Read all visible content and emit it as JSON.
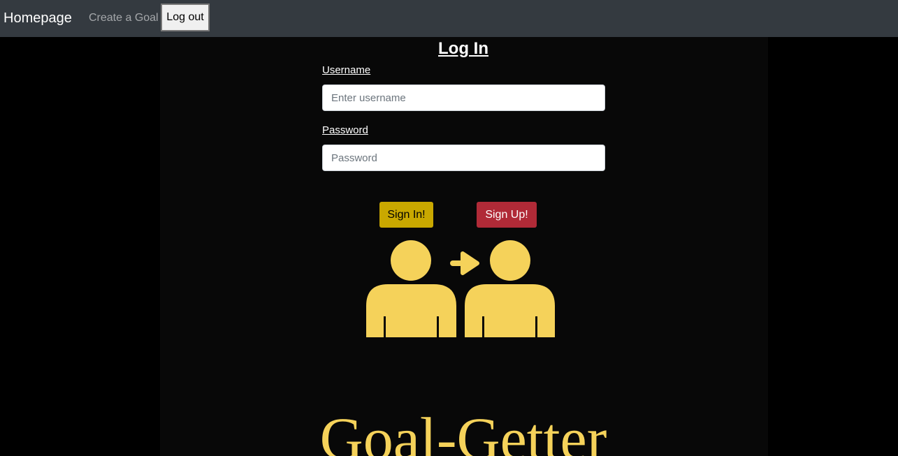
{
  "navbar": {
    "brand": "Homepage",
    "links": [
      {
        "label": "Create a Goal"
      }
    ],
    "logout_label": "Log out"
  },
  "login": {
    "title": "Log In",
    "username": {
      "label": "Username",
      "placeholder": "Enter username",
      "value": ""
    },
    "password": {
      "label": "Password",
      "placeholder": "Password",
      "value": ""
    },
    "signin_label": "Sign In!",
    "signup_label": "Sign Up!"
  },
  "illustration": {
    "icon": "user-switch-icon",
    "color": "#f5d25a"
  },
  "logo": {
    "text": "Goal-Getter",
    "color": "#f5d25a"
  },
  "colors": {
    "navbar_bg": "#343a40",
    "page_bg": "#000000",
    "panel_bg": "#080808",
    "signin_bg": "#c9a800",
    "signup_bg": "#b02a37"
  }
}
